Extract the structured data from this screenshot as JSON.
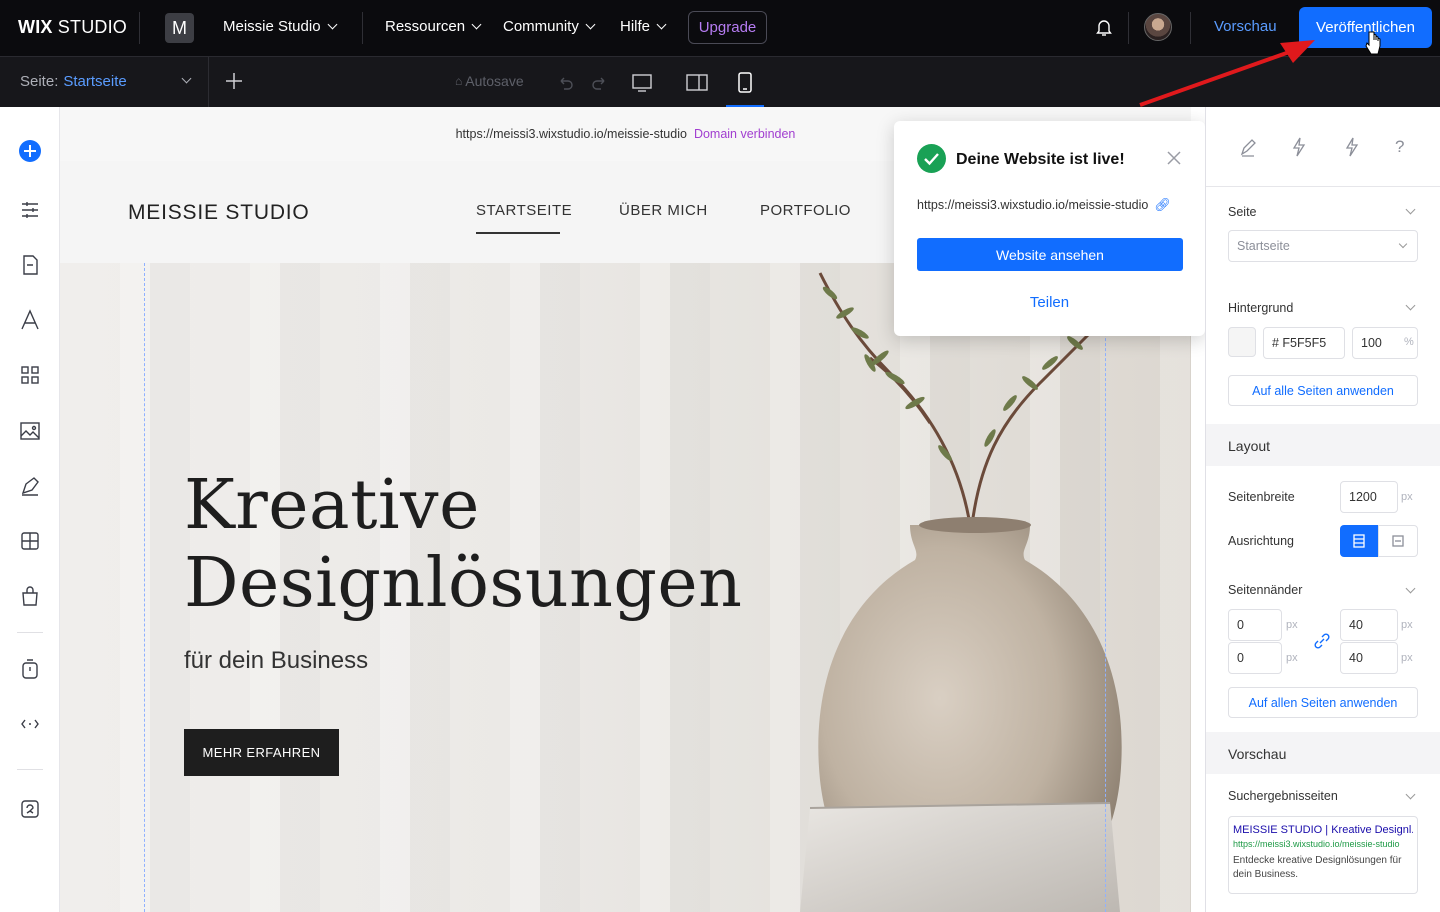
{
  "topbar": {
    "logo_bold": "WIX",
    "logo_rest": " STUDIO",
    "site_badge": "M",
    "site_name": "Meissie Studio",
    "menu": [
      "Ressourcen",
      "Community",
      "Hilfe"
    ],
    "upgrade": "Upgrade",
    "preview": "Vorschau",
    "publish": "Veröffentlichen"
  },
  "toolbar": {
    "page_prefix": "Seite:",
    "page_name": "Startseite",
    "autosave": "Autosave"
  },
  "canvas": {
    "url": "https://meissi3.wixstudio.io/meissie-studio",
    "connect_domain": "Domain verbinden",
    "brand": "MEISSIE STUDIO",
    "nav": [
      "STARTSEITE",
      "ÜBER MICH",
      "PORTFOLIO"
    ],
    "headline_line1": "Kreative",
    "headline_line2": "Designlösungen",
    "subheadline": "für dein Business",
    "cta": "MEHR ERFAHREN"
  },
  "popup": {
    "title": "Deine Website ist live!",
    "url": "https://meissi3.wixstudio.io/meissie-studio",
    "view_button": "Website ansehen",
    "share": "Teilen"
  },
  "panel": {
    "seite_label": "Seite",
    "seite_value": "Startseite",
    "hintergrund_label": "Hintergrund",
    "bg_hex": "# F5F5F5",
    "bg_opacity": "100",
    "percent": "%",
    "apply_all_bg": "Auf alle Seiten anwenden",
    "layout_title": "Layout",
    "seitenbreite_label": "Seitenbreite",
    "seitenbreite_value": "1200",
    "px": "px",
    "ausrichtung_label": "Ausrichtung",
    "seitenraender_label": "Seitennänder",
    "margins": [
      "0",
      "40",
      "0",
      "40"
    ],
    "apply_all_margins": "Auf allen Seiten anwenden",
    "vorschau_title": "Vorschau",
    "suchergebnis_label": "Suchergebnisseiten",
    "serp_title": "MEISSIE STUDIO | Kreative Designl...",
    "serp_url": "https://meissi3.wixstudio.io/meissie-studio",
    "serp_desc": "Entdecke kreative Designlösungen für dein Business."
  },
  "colors": {
    "accent": "#116dff",
    "upgrade": "#b67cf2",
    "success": "#19a155",
    "domain_link": "#a13ed0",
    "serp_url": "#1e9a46"
  }
}
